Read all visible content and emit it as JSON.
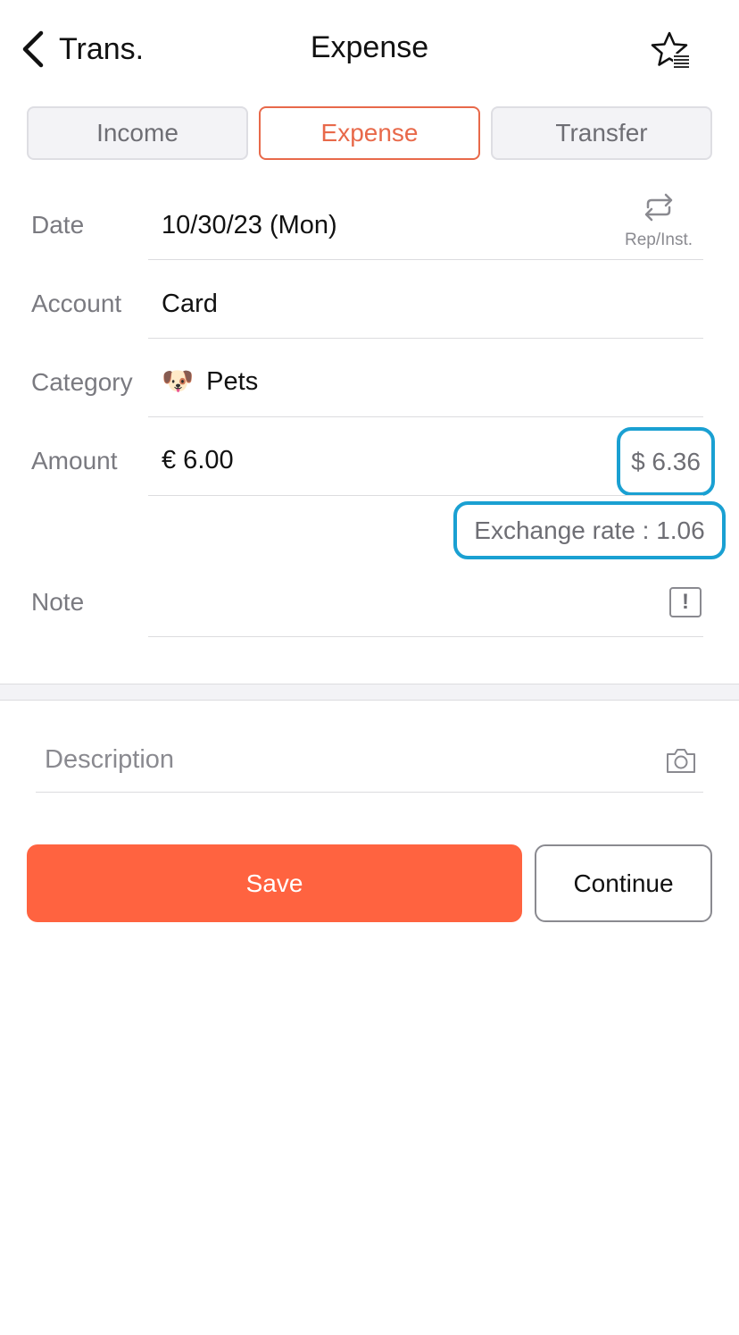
{
  "header": {
    "back_label": "Trans.",
    "title": "Expense",
    "back_icon": "chevron-left-icon",
    "favorite_icon": "star-list-icon"
  },
  "tabs": [
    {
      "label": "Income",
      "active": false
    },
    {
      "label": "Expense",
      "active": true
    },
    {
      "label": "Transfer",
      "active": false
    }
  ],
  "form": {
    "date": {
      "label": "Date",
      "value": "10/30/23 (Mon)"
    },
    "repeat": {
      "label": "Rep/Inst.",
      "icon": "repeat-icon"
    },
    "account": {
      "label": "Account",
      "value": "Card"
    },
    "category": {
      "label": "Category",
      "emoji": "🐶",
      "value": "Pets"
    },
    "amount": {
      "label": "Amount",
      "value": "€ 6.00",
      "converted": "$ 6.36"
    },
    "exchange_rate": "Exchange rate : 1.06",
    "note": {
      "label": "Note",
      "icon": "exclamation-box-icon"
    }
  },
  "description": {
    "placeholder": "Description",
    "value": "",
    "icon": "camera-icon"
  },
  "actions": {
    "save_label": "Save",
    "continue_label": "Continue"
  },
  "colors": {
    "accent": "#ff6340",
    "active_tab": "#e8694a",
    "highlight": "#1aa0d2"
  }
}
